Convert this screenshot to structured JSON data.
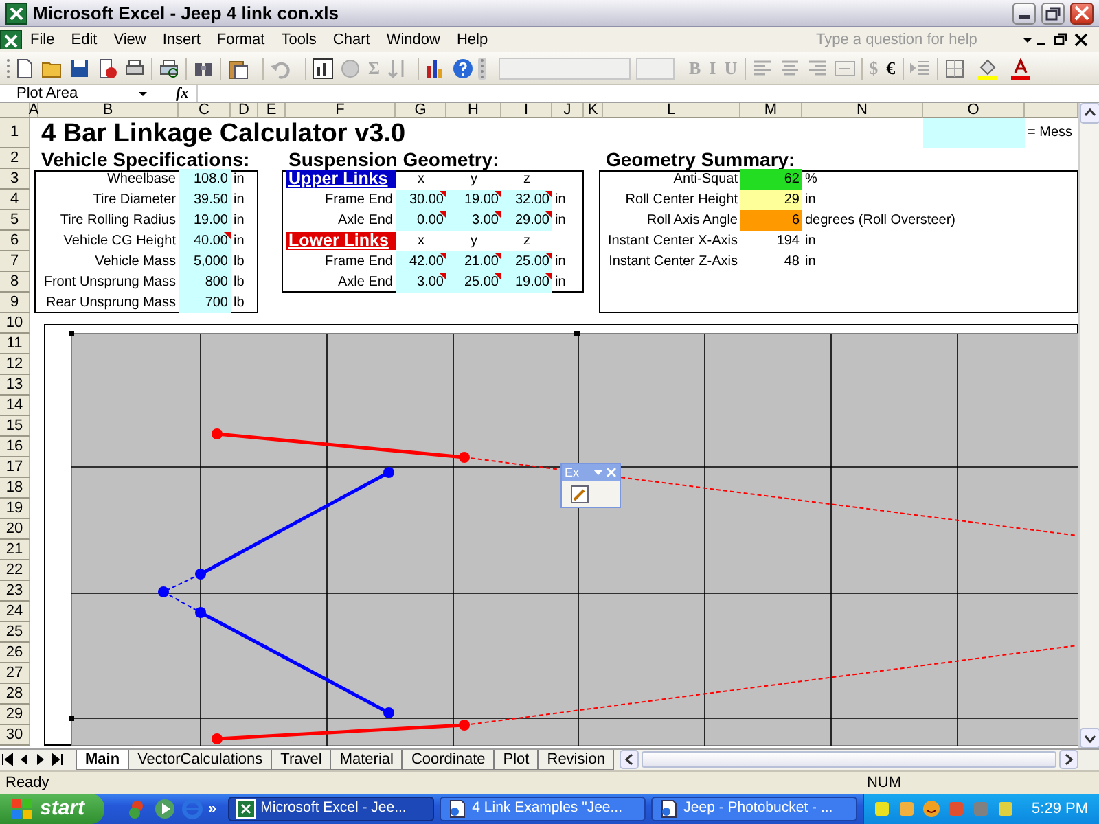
{
  "window": {
    "title": "Microsoft Excel - Jeep 4 link con.xls"
  },
  "menu": [
    "File",
    "Edit",
    "View",
    "Insert",
    "Format",
    "Tools",
    "Chart",
    "Window",
    "Help"
  ],
  "help_box": {
    "placeholder": "Type a question for help"
  },
  "toolbar": {
    "text_buttons": [
      {
        "label": "Σ",
        "disabled": true
      },
      {
        "label": "B",
        "disabled": true
      },
      {
        "label": "I",
        "disabled": true
      },
      {
        "label": "U",
        "disabled": true
      },
      {
        "label": "$",
        "disabled": true
      },
      {
        "label": "€",
        "disabled": false
      }
    ]
  },
  "formula_bar": {
    "name_box": "Plot Area",
    "fx": "fx"
  },
  "columns": [
    "A",
    "B",
    "C",
    "D",
    "E",
    "F",
    "G",
    "H",
    "I",
    "J",
    "K",
    "L",
    "M",
    "N",
    "O"
  ],
  "rows": [
    "1",
    "2",
    "3",
    "4",
    "5",
    "6",
    "7",
    "8",
    "9",
    "10",
    "11",
    "12",
    "13",
    "14",
    "15",
    "16",
    "17",
    "18",
    "19",
    "20",
    "21",
    "22",
    "23",
    "24",
    "25",
    "26",
    "27",
    "28",
    "29",
    "30"
  ],
  "sheet": {
    "title": "4 Bar Linkage Calculator v3.0",
    "legend": {
      "text": "= Mess"
    },
    "vehicle": {
      "heading": "Vehicle Specifications:",
      "rows": [
        {
          "label": "Wheelbase",
          "value": "108.0",
          "unit": "in",
          "comment": false
        },
        {
          "label": "Tire Diameter",
          "value": "39.50",
          "unit": "in",
          "comment": false
        },
        {
          "label": "Tire Rolling Radius",
          "value": "19.00",
          "unit": "in",
          "comment": false
        },
        {
          "label": "Vehicle CG Height",
          "value": "40.00",
          "unit": "in",
          "comment": true
        },
        {
          "label": "Vehicle Mass",
          "value": "5,000",
          "unit": "lb",
          "comment": false
        },
        {
          "label": "Front Unsprung Mass",
          "value": "800",
          "unit": "lb",
          "comment": false
        },
        {
          "label": "Rear Unsprung Mass",
          "value": "700",
          "unit": "lb",
          "comment": false
        }
      ]
    },
    "suspension": {
      "heading": "Suspension Geometry:",
      "groups": [
        {
          "name": "Upper Links",
          "color": "#0000c8",
          "axes": [
            "x",
            "y",
            "z"
          ],
          "rows": [
            {
              "label": "Frame End",
              "values": [
                "30.00",
                "19.00",
                "32.00"
              ],
              "unit": "in",
              "comment": true
            },
            {
              "label": "Axle End",
              "values": [
                "0.00",
                "3.00",
                "29.00"
              ],
              "unit": "in",
              "comment": true
            }
          ]
        },
        {
          "name": "Lower Links",
          "color": "#e00000",
          "axes": [
            "x",
            "y",
            "z"
          ],
          "rows": [
            {
              "label": "Frame End",
              "values": [
                "42.00",
                "21.00",
                "25.00"
              ],
              "unit": "in",
              "comment": true
            },
            {
              "label": "Axle End",
              "values": [
                "3.00",
                "25.00",
                "19.00"
              ],
              "unit": "in",
              "comment": true
            }
          ]
        }
      ]
    },
    "summary": {
      "heading": "Geometry Summary:",
      "rows": [
        {
          "label": "Anti-Squat",
          "value": "62",
          "unit": "%",
          "color": "#22dd22"
        },
        {
          "label": "Roll Center Height",
          "value": "29",
          "unit": "in",
          "color": "#ffff99"
        },
        {
          "label": "Roll Axis Angle",
          "value": "6",
          "unit": "degrees (Roll Oversteer)",
          "color": "#ff9900"
        },
        {
          "label": "Instant Center X-Axis",
          "value": "194",
          "unit": "in"
        },
        {
          "label": "Instant Center Z-Axis",
          "value": "48",
          "unit": "in"
        }
      ]
    }
  },
  "chart_toolbar": {
    "title": "Ex"
  },
  "sheet_tabs": [
    {
      "label": "Main",
      "selected": true
    },
    {
      "label": "VectorCalculations",
      "selected": false
    },
    {
      "label": "Travel",
      "selected": false
    },
    {
      "label": "Material",
      "selected": false
    },
    {
      "label": "Coordinate",
      "selected": false
    },
    {
      "label": "Plot",
      "selected": false
    },
    {
      "label": "Revision",
      "selected": false
    }
  ],
  "status_bar": {
    "left": "Ready",
    "num": "NUM"
  },
  "taskbar": {
    "start": "start",
    "overflow": "»",
    "tasks": [
      {
        "label": "Microsoft Excel - Jee...",
        "selected": true
      },
      {
        "label": "4 Link Examples \"Jee...",
        "selected": false
      },
      {
        "label": "Jeep - Photobucket - ...",
        "selected": false
      }
    ],
    "clock": "5:29 PM"
  }
}
